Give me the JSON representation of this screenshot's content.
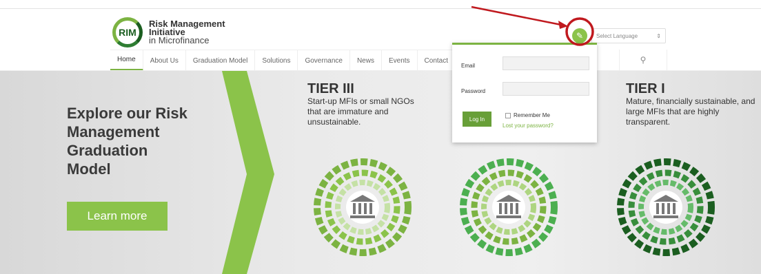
{
  "header": {
    "logo_text": "RIM",
    "org_line1": "Risk Management",
    "org_line2": "Initiative",
    "org_line3": "in Microfinance",
    "language_placeholder": "Select Language",
    "language_caret": "⇕"
  },
  "nav": {
    "items": [
      {
        "label": "Home"
      },
      {
        "label": "About Us"
      },
      {
        "label": "Graduation Model"
      },
      {
        "label": "Solutions"
      },
      {
        "label": "Governance"
      },
      {
        "label": "News"
      },
      {
        "label": "Events"
      },
      {
        "label": "Contact"
      }
    ],
    "search_icon": "search-icon"
  },
  "hero": {
    "title_line1": "Explore our Risk",
    "title_line2": "Management",
    "title_line3": "Graduation",
    "title_line4": "Model",
    "learn_more": "Learn more",
    "tier3_title": "TIER III",
    "tier3_desc": "Start-up MFIs or small NGOs that are immature and unsustainable.",
    "tier1_title": "TIER I",
    "tier1_desc": "Mature, financially sustainable, and large MFIs that are highly transparent."
  },
  "login": {
    "email_label": "Email",
    "password_label": "Password",
    "login_button": "Log In",
    "remember_me": "Remember Me",
    "lost_password": "Lost your password?"
  },
  "colors": {
    "accent": "#7cb342",
    "dark_green": "#1b5e20",
    "annotation": "#c0191e"
  }
}
